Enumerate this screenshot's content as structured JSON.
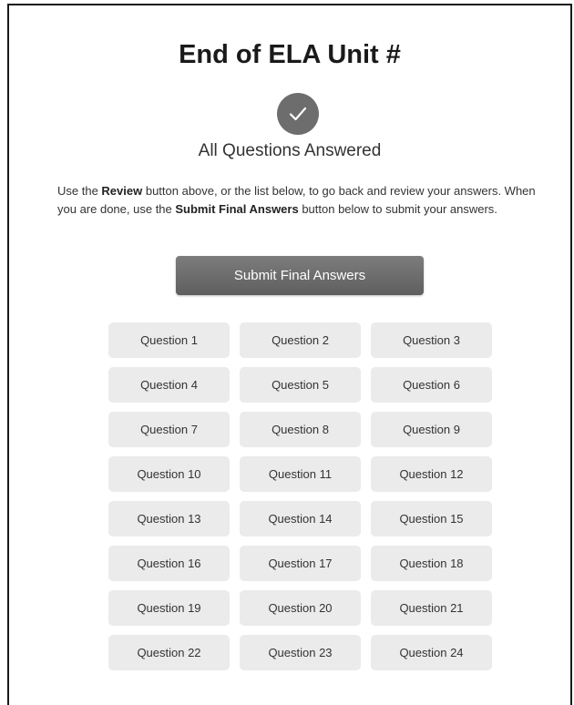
{
  "page": {
    "title": "End of ELA Unit #",
    "status_text": "All Questions Answered",
    "status_icon": "checkmark-icon"
  },
  "instructions": {
    "part1": "Use the ",
    "review_label": "Review",
    "part2": " button above, or the list below, to go back and review your answers. When you are done, use the ",
    "submit_label": "Submit Final Answers",
    "part3": " button below to submit your answers."
  },
  "submit_button": {
    "label": "Submit Final Answers"
  },
  "questions": [
    "Question 1",
    "Question 2",
    "Question 3",
    "Question 4",
    "Question 5",
    "Question 6",
    "Question 7",
    "Question 8",
    "Question 9",
    "Question 10",
    "Question 11",
    "Question 12",
    "Question 13",
    "Question 14",
    "Question 15",
    "Question 16",
    "Question 17",
    "Question 18",
    "Question 19",
    "Question 20",
    "Question 21",
    "Question 22",
    "Question 23",
    "Question 24"
  ],
  "colors": {
    "check_circle": "#6d6d6d",
    "submit_button": "#6a6a6a",
    "question_button": "#ebebeb"
  }
}
